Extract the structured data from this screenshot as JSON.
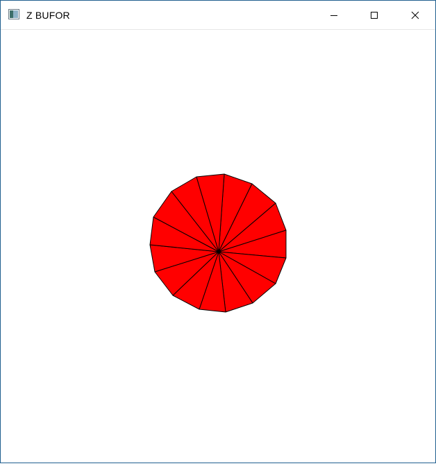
{
  "window": {
    "title": "Z BUFOR",
    "icon": "app-window-icon",
    "controls": {
      "minimize_icon": "minimize-icon",
      "maximize_icon": "maximize-icon",
      "close_icon": "close-icon"
    }
  },
  "scene": {
    "fill_color": "#ff0000",
    "edge_color": "#000000",
    "segment_count": 16,
    "shape": "red-fan-disc"
  },
  "colors": {
    "window_border": "#1f5f8f",
    "titlebar_bg": "#ffffff",
    "canvas_bg": "#ffffff"
  }
}
